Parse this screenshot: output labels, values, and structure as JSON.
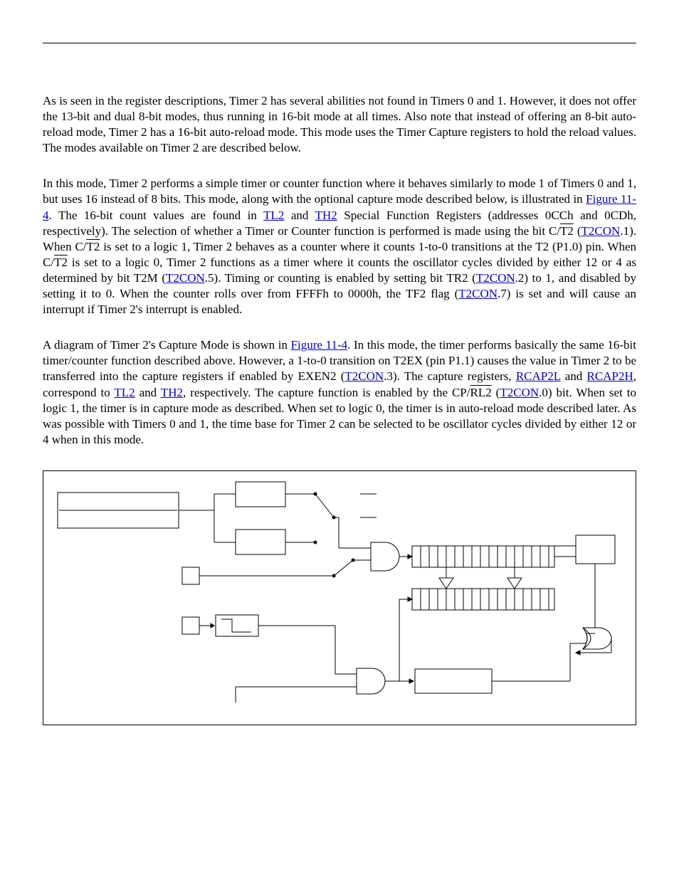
{
  "para1": {
    "t1": "As is seen in the register descriptions, Timer 2 has several abilities not found in Timers 0 and 1. However, it does not offer the 13-bit and dual 8-bit modes, thus running in 16-bit mode at all times. Also note that instead of offering an 8-bit auto-reload mode, Timer 2 has a 16-bit auto-reload mode. This mode uses the Timer Capture registers to hold the reload values. The modes available on Timer 2 are described below."
  },
  "para2": {
    "t1": "In this mode, Timer 2 performs a simple timer or counter function where it behaves similarly to mode 1 of Timers 0 and 1, but uses 16 instead of 8 bits. This mode, along with the optional capture mode described below, is illustrated in ",
    "fig": "Figure 11-4",
    "t2": ". The 16-bit count values are found in ",
    "tl2": "TL2",
    "t3": " and ",
    "th2": "TH2",
    "t4": " Special Function Registers (addresses 0CCh and 0CDh, respectively). The selection of whether a Timer or Counter function is performed is made using the bit C/",
    "ov1": "T2",
    "t5": " (",
    "t2con_a": "T2CON",
    "t6": ".1). When C/",
    "ov2": "T2",
    "t7": " is set to a logic 1, Timer 2 behaves as a counter where it counts 1-to-0 transitions at the T2 (P1.0) pin. When C/",
    "ov3": "T2",
    "t8": " is set to a logic 0, Timer 2 functions as a timer where it counts the oscillator cycles divided by either 12 or 4 as determined by bit T2M (",
    "t2con_b": "T2CON",
    "t9": ".5). Timing or counting is enabled by setting bit TR2 (",
    "t2con_c": "T2CON",
    "t10": ".2) to 1, and disabled by setting it to 0. When the counter rolls over from FFFFh to 0000h, the TF2 flag (",
    "t2con_d": "T2CON",
    "t11": ".7) is set and will cause an interrupt if Timer 2's interrupt is enabled."
  },
  "para3": {
    "t1": "A diagram of Timer 2's Capture Mode is shown in ",
    "fig": "Figure 11-4",
    "t2": ". In this mode, the timer performs basically the same 16-bit timer/counter function described above. However, a 1-to-0 transition on T2EX (pin P1.1) causes the value in Timer 2 to be transferred into the capture registers if enabled by EXEN2 (",
    "t2con_a": "T2CON",
    "t3": ".3). The capture registers, ",
    "rcap2l": "RCAP2L",
    "t4": " and ",
    "rcap2h": "RCAP2H",
    "t5": ", correspond to ",
    "tl2": "TL2",
    "t6": " and ",
    "th2": "TH2",
    "t7": ", respectively. The capture function is enabled by the CP/",
    "ov1": "RL2",
    "t8": " (",
    "t2con_b": "T2CON",
    "t9": ".0) bit. When set to logic 1, the timer is in capture mode as described. When set to logic 0, the timer is in auto-reload mode described later. As was possible with Timers 0 and 1, the time base for Timer 2 can be selected to be oscillator cycles divided by either 12 or 4 when in this mode."
  }
}
